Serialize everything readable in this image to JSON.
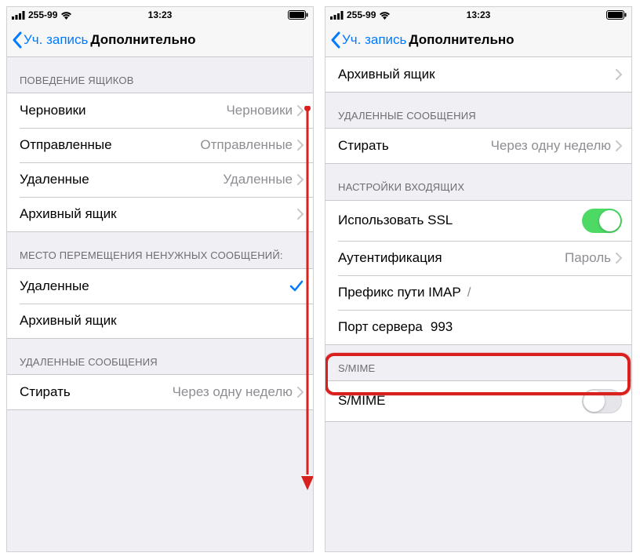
{
  "status": {
    "carrier": "255-99",
    "time": "13:23"
  },
  "nav": {
    "back": "Уч. запись",
    "title": "Дополнительно"
  },
  "left": {
    "section1_header": "ПОВЕДЕНИЕ ЯЩИКОВ",
    "drafts_label": "Черновики",
    "drafts_value": "Черновики",
    "sent_label": "Отправленные",
    "sent_value": "Отправленные",
    "deleted_label": "Удаленные",
    "deleted_value": "Удаленные",
    "archive_label": "Архивный ящик",
    "section2_header": "МЕСТО ПЕРЕМЕЩЕНИЯ НЕНУЖНЫХ СООБЩЕНИЙ:",
    "opt_deleted": "Удаленные",
    "opt_archive": "Архивный ящик",
    "section3_header": "УДАЛЕННЫЕ СООБЩЕНИЯ",
    "erase_label": "Стирать",
    "erase_value": "Через одну неделю"
  },
  "right": {
    "archive_label": "Архивный ящик",
    "section_deleted": "УДАЛЕННЫЕ СООБЩЕНИЯ",
    "erase_label": "Стирать",
    "erase_value": "Через одну неделю",
    "section_incoming": "НАСТРОЙКИ ВХОДЯЩИХ",
    "ssl_label": "Использовать SSL",
    "auth_label": "Аутентификация",
    "auth_value": "Пароль",
    "imap_prefix_label": "Префикс пути IMAP",
    "imap_prefix_value": "/",
    "port_label": "Порт сервера",
    "port_value": "993",
    "section_smime": "S/MIME",
    "smime_label": "S/MIME"
  }
}
